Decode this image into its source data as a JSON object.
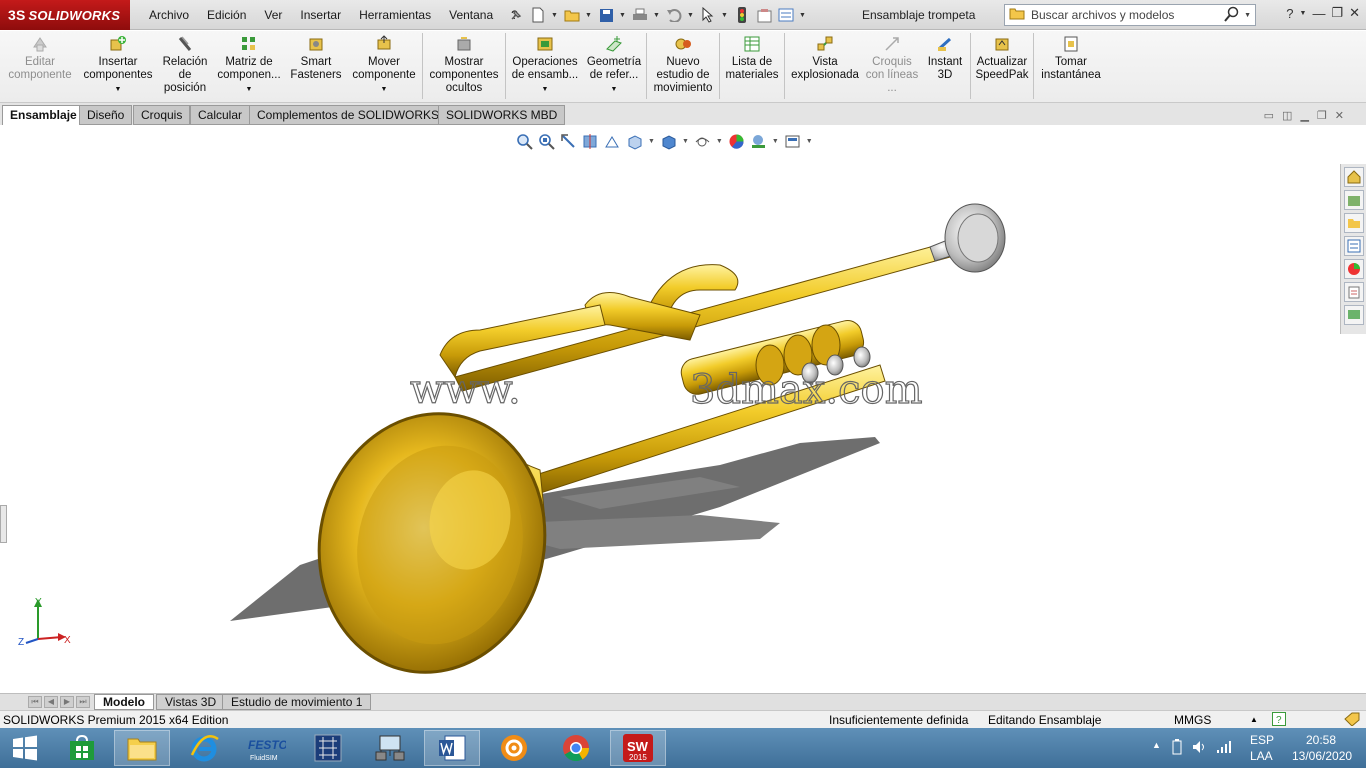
{
  "app": {
    "brand": "SOLIDWORKS",
    "brand_prefix": "3S",
    "document_title": "Ensamblaje trompeta",
    "accent_color": "#c41a1a"
  },
  "menu": [
    "Archivo",
    "Edición",
    "Ver",
    "Insertar",
    "Herramientas",
    "Ventana",
    "?"
  ],
  "search": {
    "placeholder": "Buscar archivos y modelos"
  },
  "window_controls": {
    "help": "?",
    "minimize": "—",
    "restore": "❐",
    "close": "✕"
  },
  "ribbon": {
    "buttons": [
      {
        "label": "Editar componente",
        "icon": "edit-component-icon",
        "enabled": false,
        "dropdown": false
      },
      {
        "label": "Insertar componentes",
        "icon": "insert-components-icon",
        "enabled": true,
        "dropdown": true
      },
      {
        "label": "Relación de posición",
        "icon": "mate-icon",
        "enabled": true,
        "dropdown": false
      },
      {
        "label": "Matriz de componen...",
        "icon": "component-pattern-icon",
        "enabled": true,
        "dropdown": true
      },
      {
        "label": "Smart Fasteners",
        "icon": "smart-fasteners-icon",
        "enabled": true,
        "dropdown": false
      },
      {
        "label": "Mover componente",
        "icon": "move-component-icon",
        "enabled": true,
        "dropdown": true
      },
      {
        "label": "Mostrar componentes ocultos",
        "icon": "show-hidden-icon",
        "enabled": true,
        "dropdown": false
      },
      {
        "label": "Operaciones de ensamb...",
        "icon": "assembly-features-icon",
        "enabled": true,
        "dropdown": true
      },
      {
        "label": "Geometría de refer...",
        "icon": "reference-geometry-icon",
        "enabled": true,
        "dropdown": true
      },
      {
        "label": "Nuevo estudio de movimiento",
        "icon": "motion-study-icon",
        "enabled": true,
        "dropdown": false
      },
      {
        "label": "Lista de materiales",
        "icon": "bom-icon",
        "enabled": true,
        "dropdown": false
      },
      {
        "label": "Vista explosionada",
        "icon": "exploded-view-icon",
        "enabled": true,
        "dropdown": false
      },
      {
        "label": "Croquis con líneas ...",
        "icon": "explode-line-sketch-icon",
        "enabled": false,
        "dropdown": false
      },
      {
        "label": "Instant 3D",
        "icon": "instant3d-icon",
        "enabled": true,
        "dropdown": false
      },
      {
        "label": "Actualizar SpeedPak",
        "icon": "speedpak-icon",
        "enabled": true,
        "dropdown": false
      },
      {
        "label": "Tomar instantánea",
        "icon": "snapshot-icon",
        "enabled": true,
        "dropdown": false
      }
    ]
  },
  "tabs": [
    "Ensamblaje",
    "Diseño",
    "Croquis",
    "Calcular",
    "Complementos de SOLIDWORKS",
    "SOLIDWORKS MBD"
  ],
  "active_tab": "Ensamblaje",
  "viewport": {
    "watermark": "3dmax.com",
    "watermark_prefix": "www.",
    "triad": {
      "x": "X",
      "y": "Y",
      "z": "Z"
    }
  },
  "bottom_tabs": [
    "Modelo",
    "Vistas 3D",
    "Estudio de movimiento 1"
  ],
  "active_bottom_tab": "Modelo",
  "status": {
    "product": "SOLIDWORKS Premium 2015 x64 Edition",
    "definition": "Insuficientemente definida",
    "mode": "Editando Ensamblaje",
    "units": "MMGS",
    "units_caret": "▲"
  },
  "taskbar": {
    "apps": [
      "start",
      "store",
      "explorer",
      "internet-explorer",
      "festo-fluidsim",
      "circuit-app",
      "network-app",
      "word",
      "settings-app",
      "chrome",
      "solidworks-2015"
    ],
    "solidworks_badge": "2015",
    "festo_label": "FESTO",
    "festo_sublabel": "FluidSIM",
    "language": "ESP",
    "layout": "LAA",
    "time": "20:58",
    "date": "13/06/2020"
  }
}
